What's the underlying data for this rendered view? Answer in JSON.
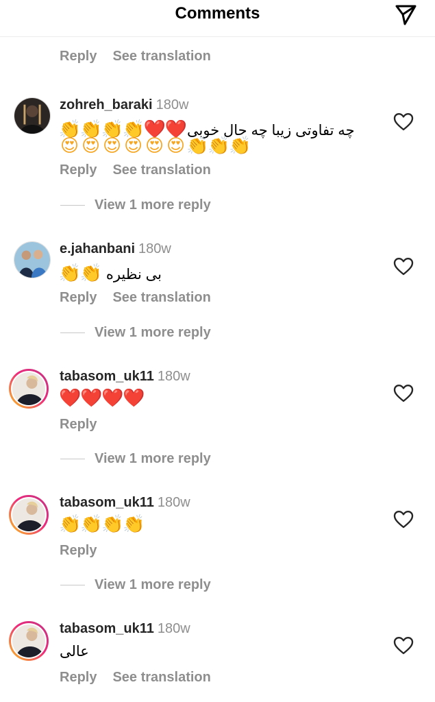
{
  "header": {
    "title": "Comments",
    "send_icon": "paper-plane-icon"
  },
  "top_actions": {
    "reply": "Reply",
    "see_translation": "See translation"
  },
  "comments": [
    {
      "username": "zohreh_baraki",
      "time": "180w",
      "text": "چه تفاوتی زیبا چه حال خوبی",
      "emoji_line1": [
        "👏",
        "👏",
        "👏",
        "👏",
        "❤️",
        "❤️"
      ],
      "emoji_line2": [
        "😍",
        "😍",
        "😍",
        "😍",
        "😍",
        "😍",
        "👏",
        "👏",
        "👏"
      ],
      "reply": "Reply",
      "see_translation": "See translation",
      "view_more": "View 1 more reply",
      "avatar": "avatar-photo",
      "like_icon": "heart-outline-icon"
    },
    {
      "username": "e.jahanbani",
      "time": "180w",
      "text": "بی نظیره",
      "emojis": [
        "👏",
        "👏"
      ],
      "reply": "Reply",
      "see_translation": "See translation",
      "view_more": "View 1 more reply",
      "avatar": "avatar-photo",
      "like_icon": "heart-outline-icon"
    },
    {
      "username": "tabasom_uk11",
      "time": "180w",
      "emojis": [
        "❤️",
        "❤️",
        "❤️",
        "❤️"
      ],
      "reply": "Reply",
      "view_more": "View 1 more reply",
      "avatar": "avatar-story-ring",
      "like_icon": "heart-outline-icon"
    },
    {
      "username": "tabasom_uk11",
      "time": "180w",
      "emojis": [
        "👏",
        "👏",
        "👏",
        "👏"
      ],
      "reply": "Reply",
      "view_more": "View 1 more reply",
      "avatar": "avatar-story-ring",
      "like_icon": "heart-outline-icon"
    },
    {
      "username": "tabasom_uk11",
      "time": "180w",
      "text": "عالی",
      "reply": "Reply",
      "see_translation": "See translation",
      "avatar": "avatar-story-ring",
      "like_icon": "heart-outline-icon"
    }
  ],
  "colors": {
    "text": "#262626",
    "secondary": "#8e8e8e",
    "heart": "#e0112b"
  }
}
